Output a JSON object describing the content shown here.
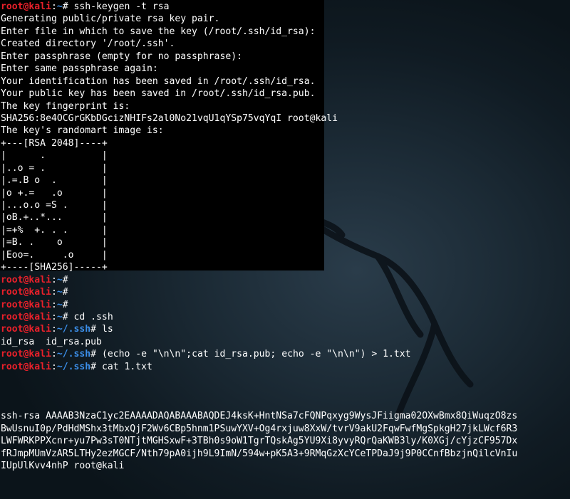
{
  "terminal": {
    "prompt_user": "root@kali",
    "home_path": "~",
    "ssh_path": "~/.ssh",
    "lines": [
      {
        "type": "prompt",
        "path": "~",
        "cmd": "ssh-keygen -t rsa"
      },
      {
        "type": "text",
        "text": "Generating public/private rsa key pair."
      },
      {
        "type": "text",
        "text": "Enter file in which to save the key (/root/.ssh/id_rsa):"
      },
      {
        "type": "text",
        "text": "Created directory '/root/.ssh'."
      },
      {
        "type": "text",
        "text": "Enter passphrase (empty for no passphrase):"
      },
      {
        "type": "text",
        "text": "Enter same passphrase again:"
      },
      {
        "type": "text",
        "text": "Your identification has been saved in /root/.ssh/id_rsa."
      },
      {
        "type": "text",
        "text": "Your public key has been saved in /root/.ssh/id_rsa.pub."
      },
      {
        "type": "text",
        "text": "The key fingerprint is:"
      },
      {
        "type": "text",
        "text": "SHA256:8e4OCGrGKbDGcizNHIFs2al0No21vqU1qYSp75vqYqI root@kali"
      },
      {
        "type": "text",
        "text": "The key's randomart image is:"
      },
      {
        "type": "text",
        "text": "+---[RSA 2048]----+"
      },
      {
        "type": "text",
        "text": "|      .          |"
      },
      {
        "type": "text",
        "text": "|..o = .          |"
      },
      {
        "type": "text",
        "text": "|.=.B o  .        |"
      },
      {
        "type": "text",
        "text": "|o +.=   .o       |"
      },
      {
        "type": "text",
        "text": "|...o.o =S .      |"
      },
      {
        "type": "text",
        "text": "|oB.+..*...       |"
      },
      {
        "type": "text",
        "text": "|=+%  +. . .      |"
      },
      {
        "type": "text",
        "text": "|=B. .    o       |"
      },
      {
        "type": "text",
        "text": "|Eoo=.     .o     |"
      },
      {
        "type": "text",
        "text": "+----[SHA256]-----+"
      },
      {
        "type": "prompt",
        "path": "~",
        "cmd": ""
      },
      {
        "type": "prompt",
        "path": "~",
        "cmd": ""
      },
      {
        "type": "prompt",
        "path": "~",
        "cmd": ""
      },
      {
        "type": "prompt",
        "path": "~",
        "cmd": "cd .ssh"
      },
      {
        "type": "prompt",
        "path": "~/.ssh",
        "cmd": "ls"
      },
      {
        "type": "text",
        "text": "id_rsa  id_rsa.pub"
      },
      {
        "type": "prompt",
        "path": "~/.ssh",
        "cmd": "(echo -e \"\\n\\n\";cat id_rsa.pub; echo -e \"\\n\\n\") > 1.txt"
      },
      {
        "type": "prompt",
        "path": "~/.ssh",
        "cmd": "cat 1.txt"
      },
      {
        "type": "text",
        "text": ""
      },
      {
        "type": "text",
        "text": ""
      },
      {
        "type": "text",
        "text": ""
      },
      {
        "type": "text",
        "text": "ssh-rsa AAAAB3NzaC1yc2EAAAADAQABAAABAQDEJ4ksK+HntNSa7cFQNPqxyg9WysJFiigma02OXwBmx8QiWuqzO8zs"
      },
      {
        "type": "text",
        "text": "BwUsnuI0p/PdHdMShx3tMbxQjF2Wv6CBp5hnm1PSuwYXV+Og4rxjuw8XxW/tvrV9akU2FqwFwfMgSpkgH27jkLWcf6R3"
      },
      {
        "type": "text",
        "text": "LWFWRKPPXcnr+yu7Pw3sT0NTjtMGHSxwF+3TBh0s9oW1TgrTQskAg5YU9Xi8yvyRQrQaKWB3ly/K0XGj/cYjzCF957Dx"
      },
      {
        "type": "text",
        "text": "fRJmpMUmVzAR5LTHy2ezMGCF/Nth79pA0ijh9L9ImN/594w+pK5A3+9RMqGzXcYCeTPDaJ9j9P0CCnfBbzjnQilcVnIu"
      },
      {
        "type": "text",
        "text": "IUpUlKvv4nhP root@kali"
      }
    ]
  },
  "colors": {
    "prompt_user": "#e8202a",
    "prompt_path": "#3b8ee8",
    "text": "#ffffff",
    "pane_bg": "#000000"
  }
}
